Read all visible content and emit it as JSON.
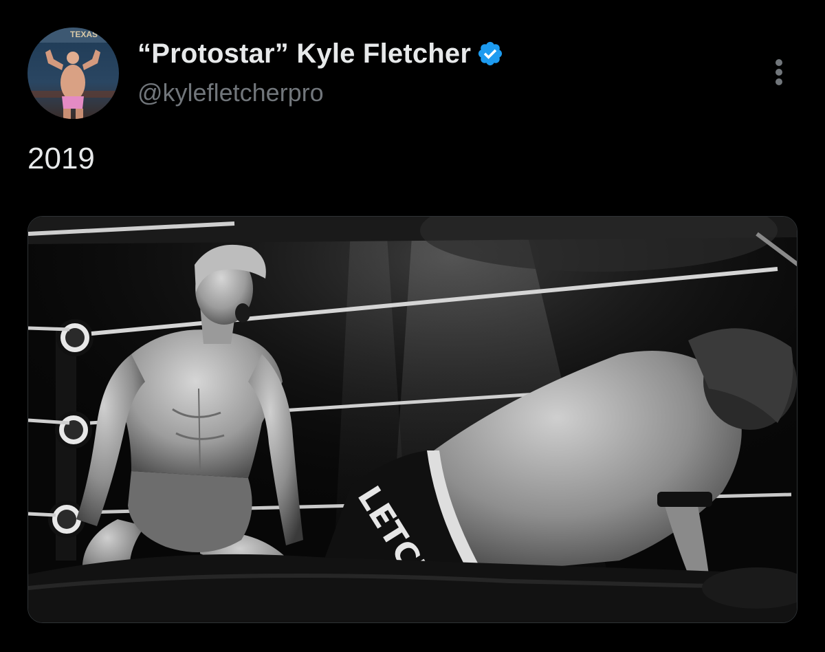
{
  "tweet": {
    "author": {
      "display_name": "“Protostar” Kyle Fletcher",
      "handle": "@kylefletcherpro",
      "verified": true,
      "verified_icon": "verified-badge-icon",
      "verified_color": "#1d9bf0"
    },
    "text": "2019",
    "more_icon": "more-options-icon",
    "media": {
      "type": "photo",
      "style": "black-and-white",
      "trunks_lettering": "LETCHE"
    }
  },
  "colors": {
    "background": "#000000",
    "primary_text": "#e7e9ea",
    "secondary_text": "#71767b",
    "border": "#2f3336",
    "accent": "#1d9bf0"
  }
}
